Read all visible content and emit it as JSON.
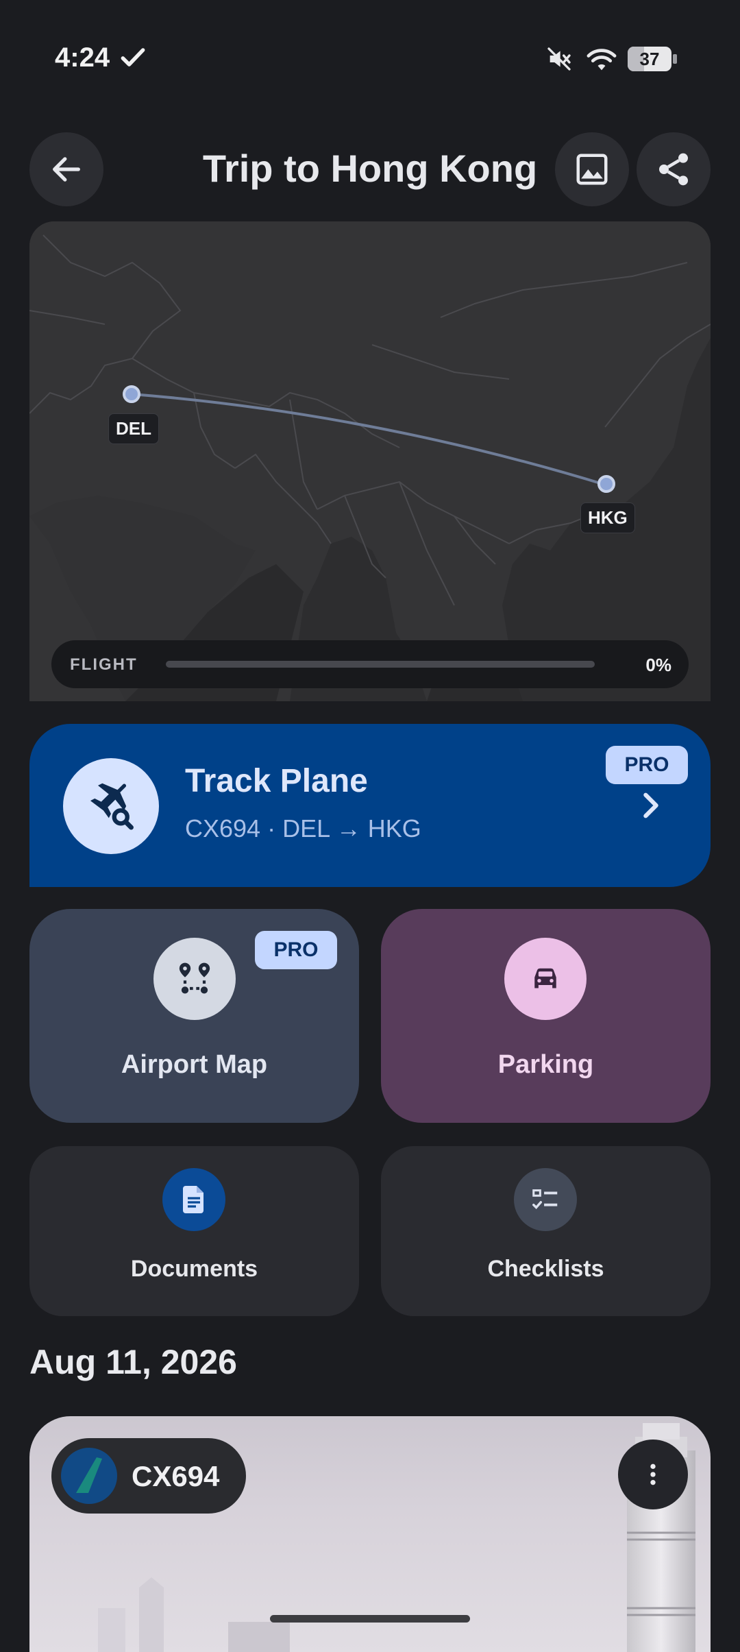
{
  "status_bar": {
    "time": "4:24",
    "battery": "37",
    "battery_level": 0.37,
    "icons": [
      "check-icon",
      "mute-icon",
      "wifi-icon",
      "battery-icon"
    ]
  },
  "header": {
    "title": "Trip to Hong Kong",
    "back_icon": "arrow-left-icon",
    "image_icon": "image-icon",
    "share_icon": "share-icon"
  },
  "map": {
    "origin": "DEL",
    "destination": "HKG",
    "progress_label": "FLIGHT",
    "progress_value": "0%",
    "progress_fraction": 0,
    "colors": {
      "route": "#6f7d98",
      "pin": "#8fa6d6"
    }
  },
  "track_plane": {
    "title": "Track Plane",
    "subtitle": "CX694 · DEL → HKG",
    "badge": "PRO",
    "icon": "plane-search-icon",
    "color": "#004189"
  },
  "tiles": {
    "airport_map": {
      "label": "Airport Map",
      "badge": "PRO",
      "icon": "route-pins-icon",
      "color": "#3a4356"
    },
    "parking": {
      "label": "Parking",
      "icon": "car-icon",
      "color": "#583c5b"
    },
    "documents": {
      "label": "Documents",
      "icon": "document-icon"
    },
    "checklists": {
      "label": "Checklists",
      "icon": "checklist-icon"
    }
  },
  "date": "Aug 11, 2026",
  "flight_card": {
    "flight_number": "CX694",
    "airline_logo": "cathay-logo",
    "more_icon": "more-vertical-icon"
  }
}
